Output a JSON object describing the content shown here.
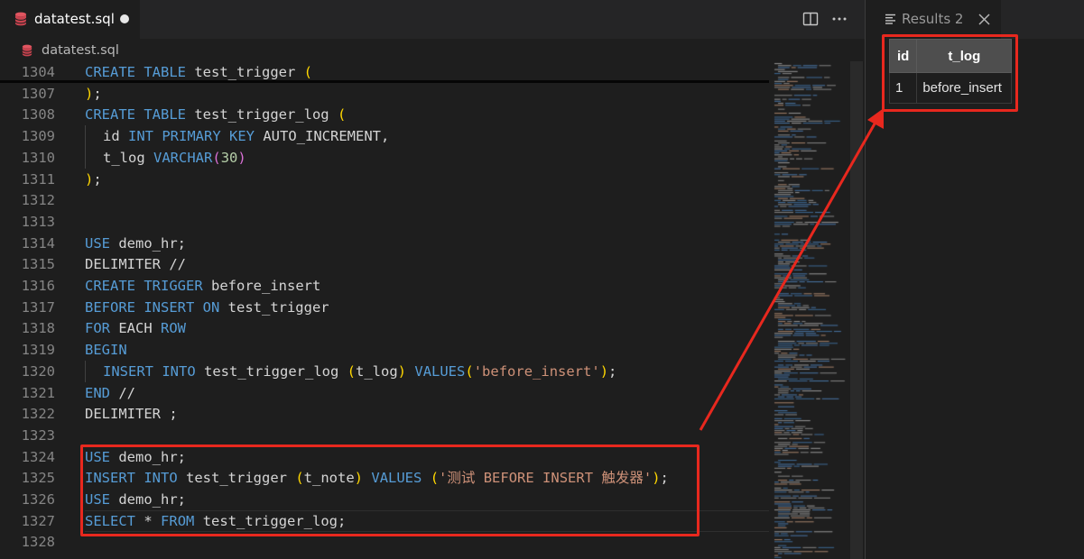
{
  "editor": {
    "tab_title": "datatest.sql",
    "breadcrumb": "datatest.sql",
    "icons": {
      "file": "database-icon",
      "split": "split-editor-icon",
      "more": "more-actions-icon"
    },
    "lines": [
      {
        "num": "1304",
        "tokens": [
          [
            "kw",
            "CREATE TABLE"
          ],
          [
            "",
            "test_trigger"
          ],
          [
            "pa",
            "("
          ]
        ]
      },
      {
        "num": "1307",
        "tokens": [
          [
            "pa",
            ")"
          ],
          [
            "",
            ";"
          ]
        ]
      },
      {
        "num": "1308",
        "tokens": [
          [
            "kw",
            "CREATE TABLE"
          ],
          [
            "",
            "test_trigger_log"
          ],
          [
            "pa",
            "("
          ]
        ]
      },
      {
        "num": "1309",
        "indent": true,
        "tokens": [
          [
            "",
            "id"
          ],
          [
            "kw",
            "INT PRIMARY KEY"
          ],
          [
            "",
            "AUTO_INCREMENT,"
          ]
        ]
      },
      {
        "num": "1310",
        "indent": true,
        "tokens": [
          [
            "",
            "t_log"
          ],
          [
            "kw",
            "VARCHAR"
          ],
          [
            "pb",
            "("
          ],
          [
            "nm",
            "30"
          ],
          [
            "pb",
            ")"
          ]
        ]
      },
      {
        "num": "1311",
        "tokens": [
          [
            "pa",
            ")"
          ],
          [
            "",
            ";"
          ]
        ]
      },
      {
        "num": "1312",
        "tokens": []
      },
      {
        "num": "1313",
        "tokens": []
      },
      {
        "num": "1314",
        "tokens": [
          [
            "kw",
            "USE"
          ],
          [
            "",
            "demo_hr;"
          ]
        ]
      },
      {
        "num": "1315",
        "tokens": [
          [
            "",
            "DELIMITER //"
          ]
        ]
      },
      {
        "num": "1316",
        "tokens": [
          [
            "kw",
            "CREATE TRIGGER"
          ],
          [
            "",
            "before_insert"
          ]
        ]
      },
      {
        "num": "1317",
        "tokens": [
          [
            "kw",
            "BEFORE INSERT ON"
          ],
          [
            "",
            "test_trigger"
          ]
        ]
      },
      {
        "num": "1318",
        "tokens": [
          [
            "kw",
            "FOR"
          ],
          [
            "",
            "EACH"
          ],
          [
            "kw",
            "ROW"
          ]
        ]
      },
      {
        "num": "1319",
        "tokens": [
          [
            "kw",
            "BEGIN"
          ]
        ]
      },
      {
        "num": "1320",
        "indent": true,
        "tokens": [
          [
            "kw",
            "INSERT INTO"
          ],
          [
            "",
            "test_trigger_log"
          ],
          [
            "pa",
            "("
          ],
          [
            "",
            "t_log"
          ],
          [
            "pa",
            ")"
          ],
          [
            "kw",
            "VALUES"
          ],
          [
            "pa",
            "("
          ],
          [
            "st",
            "'before_insert'"
          ],
          [
            "pa",
            ")"
          ],
          [
            "",
            ";"
          ]
        ]
      },
      {
        "num": "1321",
        "tokens": [
          [
            "kw",
            "END"
          ],
          [
            "",
            "//"
          ]
        ]
      },
      {
        "num": "1322",
        "tokens": [
          [
            "",
            "DELIMITER ;"
          ]
        ]
      },
      {
        "num": "1323",
        "tokens": []
      },
      {
        "num": "1324",
        "tokens": [
          [
            "kw",
            "USE"
          ],
          [
            "",
            "demo_hr;"
          ]
        ]
      },
      {
        "num": "1325",
        "tokens": [
          [
            "kw",
            "INSERT INTO"
          ],
          [
            "",
            "test_trigger"
          ],
          [
            "pa",
            "("
          ],
          [
            "",
            "t_note"
          ],
          [
            "pa",
            ")"
          ],
          [
            "kw",
            "VALUES"
          ],
          [
            "pa",
            "("
          ],
          [
            "st",
            "'测试 BEFORE INSERT 触发器'"
          ],
          [
            "pa",
            ")"
          ],
          [
            "",
            ";"
          ]
        ]
      },
      {
        "num": "1326",
        "tokens": [
          [
            "kw",
            "USE"
          ],
          [
            "",
            "demo_hr;"
          ]
        ]
      },
      {
        "num": "1327",
        "current": true,
        "tokens": [
          [
            "kw",
            "SELECT"
          ],
          [
            "",
            "*"
          ],
          [
            "kw",
            "FROM"
          ],
          [
            "",
            "test_trigger_log;"
          ]
        ]
      },
      {
        "num": "1328",
        "tokens": []
      }
    ]
  },
  "results": {
    "tab_title": "Results 2",
    "icons": {
      "results": "results-list-icon",
      "close": "close-icon"
    },
    "columns": [
      "id",
      "t_log"
    ],
    "rows": [
      [
        "1",
        "before_insert"
      ]
    ]
  },
  "colors": {
    "keyword": "#569cd6",
    "bracket_1": "#ffd700",
    "bracket_2": "#da70d6",
    "number": "#b5cea8",
    "string": "#ce9178",
    "annotation": "#e8281e"
  }
}
